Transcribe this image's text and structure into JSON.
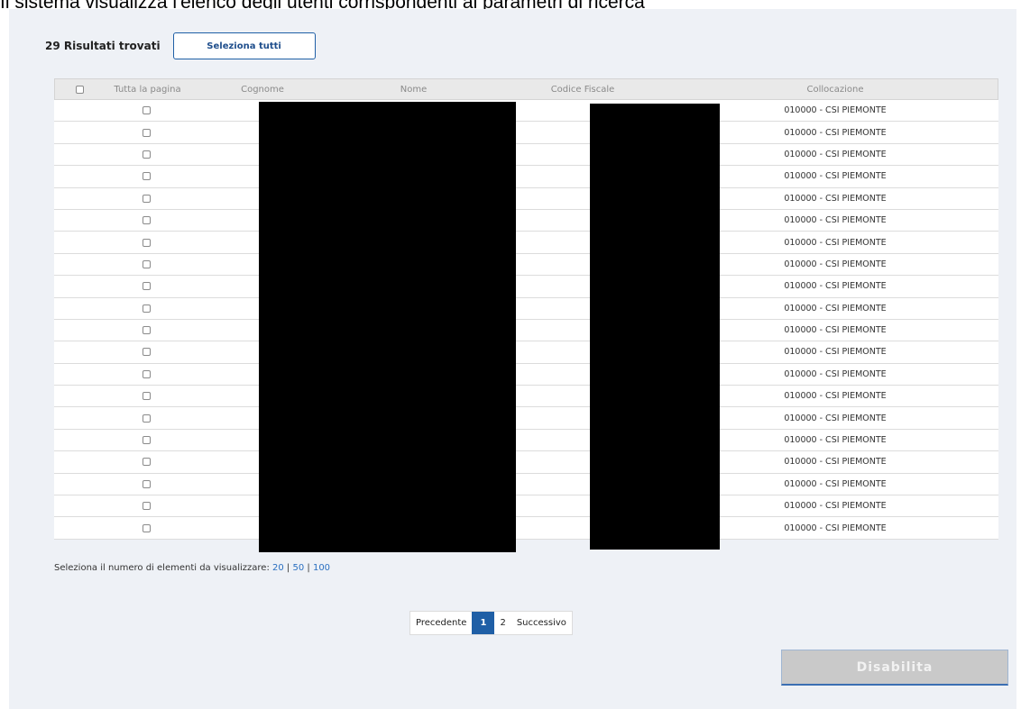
{
  "caption": "Il sistema visualizza l'elenco degli utenti corrispondenti ai parametri di ricerca",
  "results": {
    "count_label": "29 Risultati trovati",
    "select_all_label": "Seleziona tutti"
  },
  "table": {
    "columns": [
      "",
      "Tutta la pagina",
      "Cognome",
      "Nome",
      "Codice Fiscale",
      "Collocazione"
    ],
    "rows": [
      {
        "cognome": "",
        "nome": "",
        "codice_fiscale": "",
        "collocazione": "010000 - CSI PIEMONTE"
      },
      {
        "cognome": "",
        "nome": "",
        "codice_fiscale": "",
        "collocazione": "010000 - CSI PIEMONTE"
      },
      {
        "cognome": "",
        "nome": "",
        "codice_fiscale": "",
        "collocazione": "010000 - CSI PIEMONTE"
      },
      {
        "cognome": "",
        "nome": "",
        "codice_fiscale": "",
        "collocazione": "010000 - CSI PIEMONTE"
      },
      {
        "cognome": "",
        "nome": "",
        "codice_fiscale": "",
        "collocazione": "010000 - CSI PIEMONTE"
      },
      {
        "cognome": "",
        "nome": "",
        "codice_fiscale": "",
        "collocazione": "010000 - CSI PIEMONTE"
      },
      {
        "cognome": "",
        "nome": "",
        "codice_fiscale": "",
        "collocazione": "010000 - CSI PIEMONTE"
      },
      {
        "cognome": "",
        "nome": "",
        "codice_fiscale": "",
        "collocazione": "010000 - CSI PIEMONTE"
      },
      {
        "cognome": "",
        "nome": "",
        "codice_fiscale": "",
        "collocazione": "010000 - CSI PIEMONTE"
      },
      {
        "cognome": "",
        "nome": "",
        "codice_fiscale": "",
        "collocazione": "010000 - CSI PIEMONTE"
      },
      {
        "cognome": "",
        "nome": "",
        "codice_fiscale": "",
        "collocazione": "010000 - CSI PIEMONTE"
      },
      {
        "cognome": "",
        "nome": "",
        "codice_fiscale": "",
        "collocazione": "010000 - CSI PIEMONTE"
      },
      {
        "cognome": "",
        "nome": "",
        "codice_fiscale": "",
        "collocazione": "010000 - CSI PIEMONTE"
      },
      {
        "cognome": "",
        "nome": "",
        "codice_fiscale": "",
        "collocazione": "010000 - CSI PIEMONTE"
      },
      {
        "cognome": "",
        "nome": "",
        "codice_fiscale": "",
        "collocazione": "010000 - CSI PIEMONTE"
      },
      {
        "cognome": "",
        "nome": "",
        "codice_fiscale": "",
        "collocazione": "010000 - CSI PIEMONTE"
      },
      {
        "cognome": "",
        "nome": "",
        "codice_fiscale": "",
        "collocazione": "010000 - CSI PIEMONTE"
      },
      {
        "cognome": "",
        "nome": "",
        "codice_fiscale": "",
        "collocazione": "010000 - CSI PIEMONTE"
      },
      {
        "cognome": "",
        "nome": "",
        "codice_fiscale": "",
        "collocazione": "010000 - CSI PIEMONTE"
      },
      {
        "cognome": "",
        "nome": "",
        "codice_fiscale": "",
        "collocazione": "010000 - CSI PIEMONTE"
      }
    ]
  },
  "per_page": {
    "label": "Seleziona il numero di elementi da visualizzare: ",
    "options": [
      "20",
      "50",
      "100"
    ],
    "separator": " | "
  },
  "pagination": {
    "prev_label": "Precedente",
    "pages": [
      "1",
      "2"
    ],
    "active_page": "1",
    "next_label": "Successivo"
  },
  "actions": {
    "disable_label": "Disabilita"
  },
  "colors": {
    "primary": "#1f5fa6",
    "panel_bg": "#eef1f6",
    "disabled_bg": "#c9c9c9"
  }
}
